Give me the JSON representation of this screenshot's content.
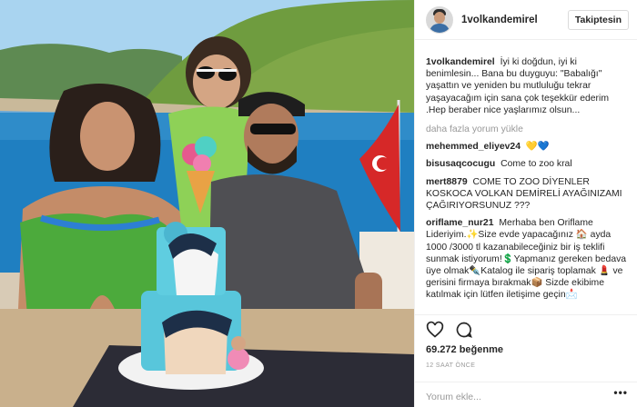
{
  "post": {
    "username": "1volkandemirel",
    "follow_label": "Takiptesin",
    "avatar_icon": "profile-avatar",
    "caption": {
      "user": "1volkandemirel",
      "text": "İyi ki doğdun, iyi ki benimlesin... Bana bu duyguyu: \"Babalığı\" yaşattın ve yeniden bu mutluluğu tekrar yaşayacağım için sana çok teşekkür ederim .Hep beraber nice yaşlarımız olsun..."
    },
    "load_more_label": "daha fazla yorum yükle",
    "comments": [
      {
        "user": "mehemmed_eliyev24",
        "text": "💛💙"
      },
      {
        "user": "bisusaqcocugu",
        "text": "Come to zoo kral"
      },
      {
        "user": "mert8879",
        "text": "COME TO ZOO DİYENLER KOSKOCA VOLKAN DEMİRELİ AYAĞINIZAMI ÇAĞIRIYORSUNUZ ???"
      },
      {
        "user": "oriflame_nur21",
        "text": "Merhaba ben Oriflame Lideriyim.✨Size evde yapacağınız 🏠 ayda 1000 /3000 tl kazanabileceğiniz bir iş teklifi sunmak istiyorum!💲Yapmanız gereken bedava üye olmak✒️Katalog ile sipariş toplamak 💄 ve gerisini firmaya bırakmak📦 Sizde ekibime katılmak için lütfen iletişime geçin📩"
      }
    ],
    "likes_label": "69.272 beğenme",
    "timestamp_label": "12 SAAT ÖNCE",
    "add_comment_placeholder": "Yorum ekle...",
    "more_label": "•••"
  },
  "colors": {
    "text": "#262626",
    "muted": "#999999",
    "border": "#efefef",
    "button_border": "#dbdbdb"
  }
}
